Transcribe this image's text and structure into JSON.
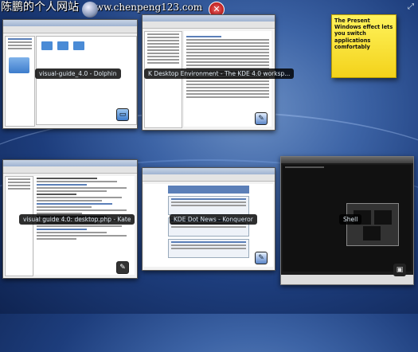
{
  "watermark": {
    "site_name": "陈鹏的个人网站",
    "url": "www.chenpeng123.com"
  },
  "windows": {
    "dolphin": {
      "label": "visual-guide_4.0 - Dolphin",
      "icon": "folder-icon"
    },
    "konqueror_kde": {
      "label": "K Desktop Environment - The KDE 4.0 worksp...",
      "icon": "konqueror-icon"
    },
    "kate": {
      "label": "visual guide 4.0: desktop.php - Kate",
      "icon": "kate-icon"
    },
    "konqueror_dot": {
      "label": "KDE Dot News - Konqueror",
      "icon": "konqueror-icon"
    },
    "shell": {
      "label": "Shell",
      "icon": "terminal-icon"
    }
  },
  "sticky_note": {
    "text": "The Present Windows effect lets you switch applications comfortably"
  },
  "colors": {
    "accent": "#1d3d7c",
    "sticky": "#f3d21a",
    "label_bg": "#000000"
  }
}
